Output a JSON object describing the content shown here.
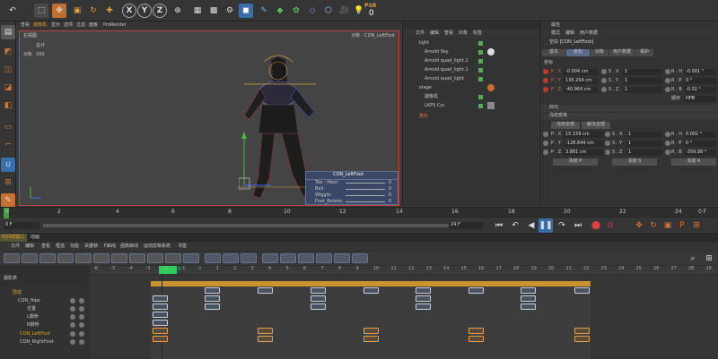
{
  "toolbar": {
    "xyz": [
      "X",
      "Y",
      "Z"
    ],
    "psr": {
      "label": "PSR",
      "value": "0"
    }
  },
  "viewport": {
    "menu": [
      "查看",
      "摄像机",
      "显示",
      "选项",
      "过滤",
      "面板",
      "ProRender"
    ],
    "camera_label": "右视图",
    "object_label": "对象 : CON_LeftFoot",
    "stats": {
      "label1": "总计",
      "label2": "对象",
      "value": "160"
    }
  },
  "hud": {
    "title": "CON_LeftFoot",
    "rows": [
      {
        "label": "Toe - Heel:",
        "value": "0"
      },
      {
        "label": "Ball:",
        "value": "0"
      },
      {
        "label": "Wiggle:",
        "value": "0"
      },
      {
        "label": "Foot_Rotate:",
        "value": "0"
      }
    ]
  },
  "object_manager": {
    "menu": [
      "文件",
      "编辑",
      "查看",
      "对象",
      "标签"
    ],
    "items": [
      {
        "name": "light",
        "indent": 0
      },
      {
        "name": "Arnold Sky",
        "indent": 1
      },
      {
        "name": "Arnold quad_light.2",
        "indent": 1
      },
      {
        "name": "Arnold quad_light.1",
        "indent": 1
      },
      {
        "name": "Arnold quad_light",
        "indent": 1
      },
      {
        "name": "stage",
        "indent": 0
      },
      {
        "name": "摄像机",
        "indent": 1
      },
      {
        "name": "LKPS Cyc",
        "indent": 1
      },
      {
        "name": "角色",
        "indent": 0
      }
    ]
  },
  "attributes": {
    "header": "属性",
    "menu": [
      "模式",
      "编辑",
      "用户数据"
    ],
    "title": "空白 [CON_LeftFoot]",
    "tabs": [
      "基本",
      "坐标",
      "对象",
      "用户数据",
      "保护"
    ],
    "section": "坐标",
    "coords": [
      {
        "p": "P . X",
        "pv": "-0.004 cm",
        "s": "S . X",
        "sv": "1",
        "r": "R . H",
        "rv": "-0.001 °"
      },
      {
        "p": "P . Y",
        "pv": "136.264 cm",
        "s": "S . Y",
        "sv": "1",
        "r": "R . P",
        "rv": "0 °"
      },
      {
        "p": "P . Z",
        "pv": "-40.964 cm",
        "s": "S . Z",
        "sv": "1",
        "r": "R . B",
        "rv": "-0.02 °"
      }
    ],
    "order_label": "顺序",
    "order_value": "HPB",
    "quat_label": "四元",
    "frozen_label": "冻结变换",
    "freeze_all": "冻结全部",
    "unfreeze_all": "解冻全部",
    "frozen": [
      {
        "p": "P . X",
        "pv": "15.159 cm",
        "s": "S . X",
        "sv": "1",
        "r": "R . H",
        "rv": "0.001 °"
      },
      {
        "p": "P . Y",
        "pv": "-128.844 cm",
        "s": "S . Y",
        "sv": "1",
        "r": "R . P",
        "rv": "0 °"
      },
      {
        "p": "P . Z",
        "pv": "3.861 cm",
        "s": "S . Z",
        "sv": "1",
        "r": "R . B",
        "rv": "-359.98 °"
      }
    ],
    "freeze_p": "冻结 P",
    "freeze_s": "冻结 S",
    "freeze_r": "冻结 R"
  },
  "timeline": {
    "ticks": [
      "0",
      "2",
      "4",
      "6",
      "8",
      "10",
      "12",
      "14",
      "16",
      "18",
      "20",
      "22",
      "24"
    ],
    "current_frame": "0 F",
    "end_frame": "24 F",
    "start_value": "0 F",
    "right_value": "0 F"
  },
  "dopesheet": {
    "tabs": [
      "时间线窗口",
      "动画"
    ],
    "menu": [
      "文件",
      "编辑",
      "查看",
      "框选",
      "功能",
      "关键帧",
      "F曲线",
      "函数曲线",
      "运动剪辑系统",
      "书签"
    ],
    "header_label": "摄影表",
    "frame_labels": [
      "-6",
      "-5",
      "-4",
      "-3",
      "-2",
      "-1",
      "0",
      "1",
      "2",
      "3",
      "4",
      "5",
      "6",
      "7",
      "8",
      "9",
      "10",
      "11",
      "12",
      "13",
      "14",
      "15",
      "16",
      "17",
      "18",
      "19",
      "20",
      "21",
      "22",
      "23",
      "24",
      "25",
      "26",
      "27",
      "28",
      "29",
      "30"
    ],
    "current_frame": "0",
    "tracks": [
      {
        "name": "层底",
        "indent": 0
      },
      {
        "name": "CON_Hips",
        "indent": 1
      },
      {
        "name": "位置",
        "indent": 2
      },
      {
        "name": "L脚骨",
        "indent": 2
      },
      {
        "name": "R脚骨",
        "indent": 2
      },
      {
        "name": "CON_LeftFoot",
        "indent": 1
      },
      {
        "name": "CON_RightFoot",
        "indent": 1
      }
    ]
  }
}
